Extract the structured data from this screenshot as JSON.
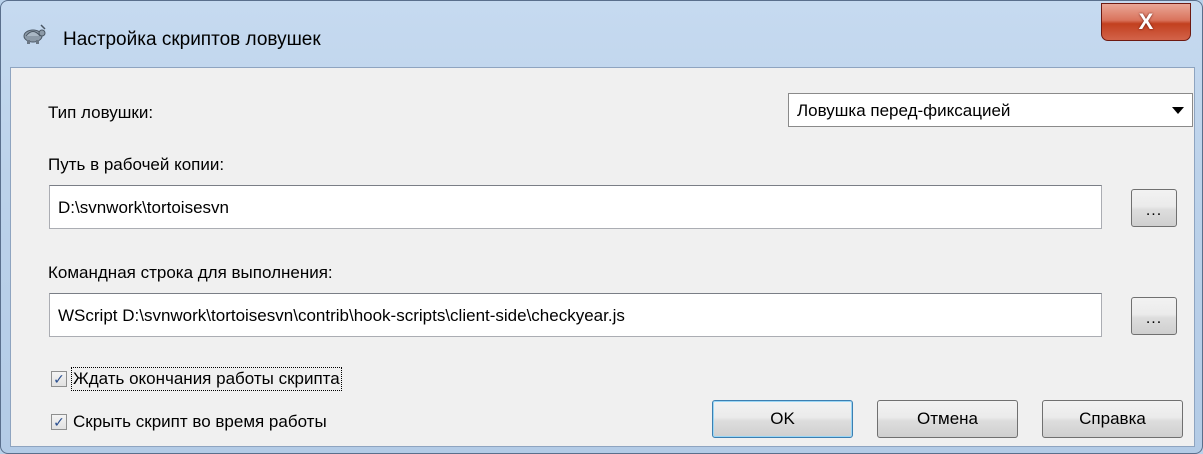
{
  "window": {
    "title": "Настройка скриптов ловушек",
    "close_glyph": "X"
  },
  "hook_type": {
    "label": "Тип ловушки:",
    "selected": "Ловушка перед-фиксацией"
  },
  "working_copy": {
    "label": "Путь в рабочей копии:",
    "value": "D:\\svnwork\\tortoisesvn",
    "browse_label": "..."
  },
  "command_line": {
    "label": "Командная строка для выполнения:",
    "value": "WScript D:\\svnwork\\tortoisesvn\\contrib\\hook-scripts\\client-side\\checkyear.js",
    "browse_label": "..."
  },
  "options": {
    "wait_label": "Ждать окончания работы скрипта",
    "wait_checked": true,
    "hide_label": "Скрыть скрипт во время работы",
    "hide_checked": true
  },
  "buttons": {
    "ok": "OK",
    "cancel": "Отмена",
    "help": "Справка"
  }
}
